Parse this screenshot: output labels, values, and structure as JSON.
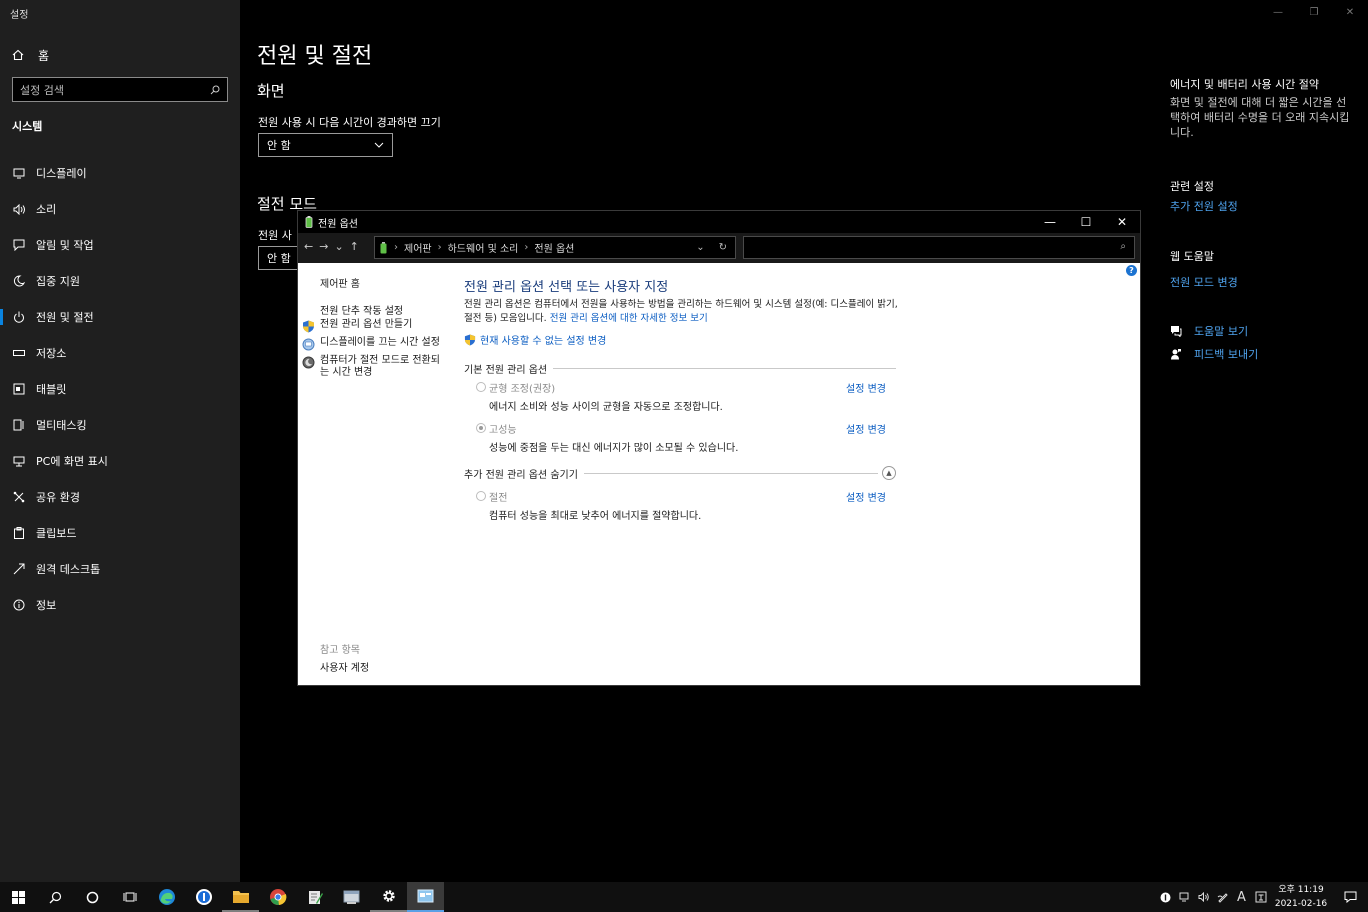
{
  "settings": {
    "app_title": "설정",
    "home_label": "홈",
    "search_placeholder": "설정 검색",
    "section_label": "시스템",
    "nav": [
      {
        "label": "디스플레이"
      },
      {
        "label": "소리"
      },
      {
        "label": "알림 및 작업"
      },
      {
        "label": "집중 지원"
      },
      {
        "label": "전원 및 절전"
      },
      {
        "label": "저장소"
      },
      {
        "label": "태블릿"
      },
      {
        "label": "멀티태스킹"
      },
      {
        "label": "PC에 화면 표시"
      },
      {
        "label": "공유 환경"
      },
      {
        "label": "클립보드"
      },
      {
        "label": "원격 데스크톱"
      },
      {
        "label": "정보"
      }
    ],
    "active_index": 4,
    "page_title": "전원 및 절전",
    "screen_heading": "화면",
    "screen_label": "전원 사용 시 다음 시간이 경과하면 끄기",
    "screen_value": "안 함",
    "sleep_heading": "절전 모드",
    "sleep_label": "전원 사용 시 다음 시간이 경과하면 PC를 절전 상태로 전환",
    "sleep_label_visible": "전원 사",
    "sleep_value": "안 함",
    "right": {
      "tip_heading": "에너지 및 배터리 사용 시간 절약",
      "tip_text": "화면 및 절전에 대해 더 짧은 시간을 선택하여 배터리 수명을 더 오래 지속시킵니다.",
      "related_heading": "관련 설정",
      "related_link": "추가 전원 설정",
      "web_help_heading": "웹 도움말",
      "web_help_link": "전원 모드 변경",
      "get_help": "도움말 보기",
      "feedback": "피드백 보내기"
    }
  },
  "power_window": {
    "title": "전원 옵션",
    "breadcrumb": [
      "제어판",
      "하드웨어 및 소리",
      "전원 옵션"
    ],
    "left": {
      "home": "제어판 홈",
      "links": [
        "전원 단추 작동 설정",
        "전원 관리 옵션 만들기",
        "디스플레이를 끄는 시간 설정",
        "컴퓨터가 절전 모드로 전환되는 시간 변경"
      ],
      "see_also": "참고 항목",
      "user_accounts": "사용자 계정"
    },
    "main": {
      "title": "전원 관리 옵션 선택 또는 사용자 지정",
      "desc": "전원 관리 옵션은 컴퓨터에서 전원을 사용하는 방법을 관리하는 하드웨어 및 시스템 설정(예: 디스플레이 밝기, 절전 등) 모음입니다. ",
      "desc_link": "전원 관리 옵션에 대한 자세한 정보 보기",
      "unavailable": "현재 사용할 수 없는 설정 변경",
      "basic_group": "기본 전원 관리 옵션",
      "extra_group": "추가 전원 관리 옵션 숨기기",
      "change_label": "설정 변경",
      "plans": [
        {
          "name": "균형 조정(권장)",
          "desc": "에너지 소비와 성능 사이의 균형을 자동으로 조정합니다.",
          "selected": false
        },
        {
          "name": "고성능",
          "desc": "성능에 중점을 두는 대신 에너지가 많이 소모될 수 있습니다.",
          "selected": true
        },
        {
          "name": "절전",
          "desc": "컴퓨터 성능을 최대로 낮추어 에너지를 절약합니다.",
          "selected": false
        }
      ]
    }
  },
  "taskbar": {
    "time": "오후 11:19",
    "date": "2021-02-16",
    "ime": "A"
  }
}
